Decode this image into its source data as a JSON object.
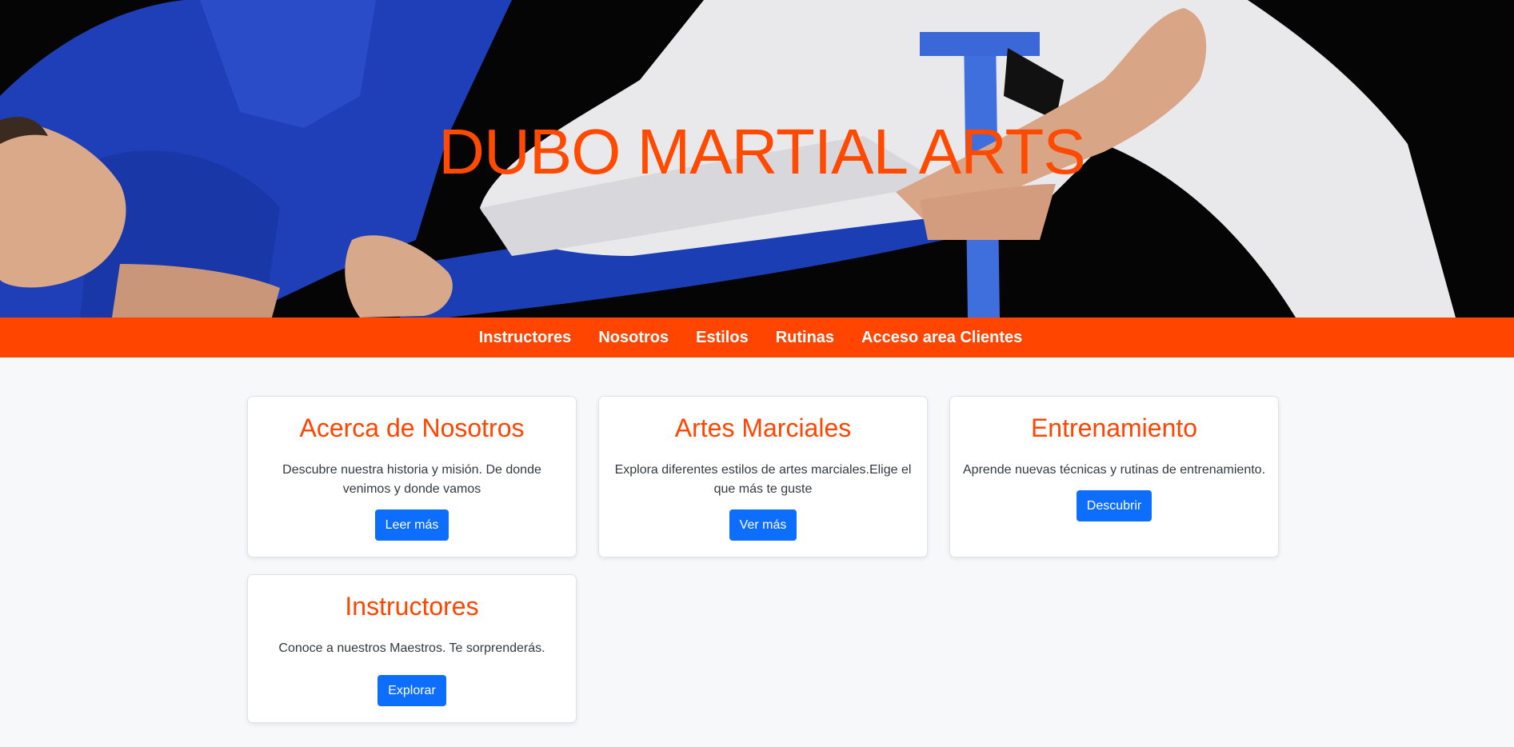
{
  "hero": {
    "title": "DUBO MARTIAL ARTS"
  },
  "nav": {
    "items": [
      {
        "label": "Instructores"
      },
      {
        "label": "Nosotros"
      },
      {
        "label": "Estilos"
      },
      {
        "label": "Rutinas"
      },
      {
        "label": "Acceso area Clientes"
      }
    ]
  },
  "cards": [
    {
      "title": "Acerca de Nosotros",
      "text": "Descubre nuestra historia y misión. De donde venimos y donde vamos",
      "button": "Leer más"
    },
    {
      "title": "Artes Marciales",
      "text": "Explora diferentes estilos de artes marciales.Elige el que más te guste",
      "button": "Ver más"
    },
    {
      "title": "Entrenamiento",
      "text": "Aprende nuevas técnicas y rutinas de entrenamiento.",
      "button": "Descubrir"
    },
    {
      "title": "Instructores",
      "text": "Conoce a nuestros Maestros. Te sorprenderás.",
      "button": "Explorar"
    }
  ],
  "colors": {
    "accent": "#ff4500",
    "button": "#0d6efd",
    "background": "#f7f8fa"
  }
}
